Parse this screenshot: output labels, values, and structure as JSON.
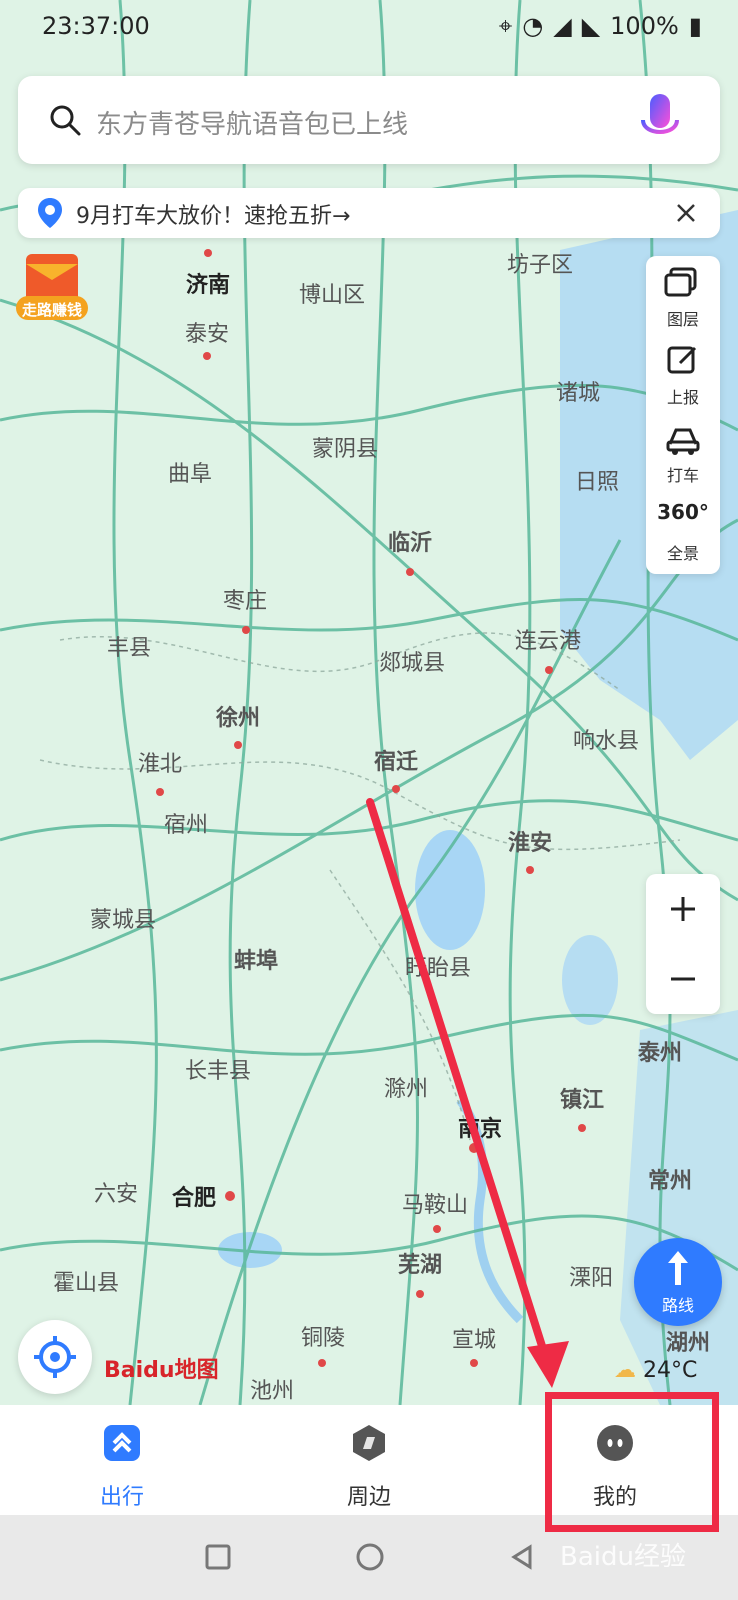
{
  "status_bar": {
    "time": "23:37:00",
    "battery": "100%"
  },
  "search": {
    "placeholder": "东方青苍导航语音包已上线"
  },
  "notice": {
    "text": "9月打车大放价！速抢五折→"
  },
  "promo": {
    "label": "走路赚钱"
  },
  "tools": [
    {
      "label": "图层"
    },
    {
      "label": "上报"
    },
    {
      "label": "打车"
    },
    {
      "label": "全景",
      "badge": "360°"
    }
  ],
  "route_button": {
    "label": "路线"
  },
  "weather": {
    "temperature": "24°C"
  },
  "map_logo": {
    "text": "Baidu地图"
  },
  "bottom_nav": [
    {
      "label": "出行",
      "active": true
    },
    {
      "label": "周边",
      "active": false
    },
    {
      "label": "我的",
      "active": false
    }
  ],
  "watermark": {
    "text": "Baidu经验"
  },
  "map_labels": [
    "济南",
    "博山区",
    "坊子区",
    "泰安",
    "诸城",
    "蒙阴县",
    "曲阜",
    "日照",
    "临沂",
    "枣庄",
    "丰县",
    "郯城县",
    "连云港",
    "徐州",
    "淮北",
    "响水县",
    "宿迁",
    "宿州",
    "淮安",
    "蒙城县",
    "蚌埠",
    "盱眙县",
    "长丰县",
    "泰州",
    "滁州",
    "镇江",
    "南京",
    "六安",
    "合肥",
    "常州",
    "马鞍山",
    "芜湖",
    "溧阳",
    "霍山县",
    "铜陵",
    "宣城",
    "湖州",
    "池州"
  ],
  "colors": {
    "accent": "#2f7bff",
    "annotation": "#ee2b45",
    "map_background": "#dff3e6",
    "water": "#a8d6f5",
    "road": "#59b89a"
  }
}
